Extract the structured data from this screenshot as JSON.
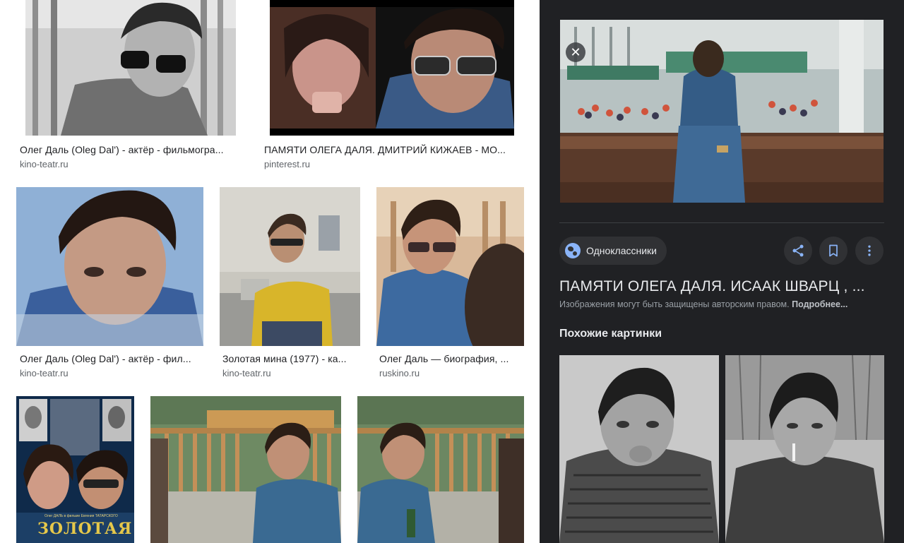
{
  "results": [
    {
      "title": "Олег Даль (Oleg Dal') - актёр - фильмогра...",
      "site": "kino-teatr.ru"
    },
    {
      "title": "ПАМЯТИ ОЛЕГА ДАЛЯ. ДМИТРИЙ КИЖАЕВ - МО...",
      "site": "pinterest.ru"
    },
    {
      "title": "Олег Даль (Oleg Dal') - актёр - фил...",
      "site": "kino-teatr.ru"
    },
    {
      "title": "Золотая мина (1977) - ка...",
      "site": "kino-teatr.ru"
    },
    {
      "title": "Олег Даль — биография, ...",
      "site": "ruskino.ru"
    }
  ],
  "poster": {
    "credit": "Олег ДАЛЬ в фильме Евгения ТАТАРСКОГО",
    "title": "ЗОЛОТАЯ МИНА"
  },
  "panel": {
    "close_symbol": "✕",
    "source": "Одноклассники",
    "title": "ПАМЯТИ ОЛЕГА ДАЛЯ. ИСААК ШВАРЦ , ...",
    "copyright_text": "Изображения могут быть защищены авторским правом.",
    "copyright_link": "Подробнее...",
    "similar_heading": "Похожие картинки"
  },
  "icons": [
    "globe-icon",
    "share-icon",
    "bookmark-icon",
    "more-vert-icon",
    "close-icon"
  ],
  "colors": {
    "panel_bg": "#202124",
    "chip_bg": "#303134",
    "accent_blue": "#8ab4f8",
    "caption_text": "#202124",
    "site_text": "#5f6368"
  }
}
